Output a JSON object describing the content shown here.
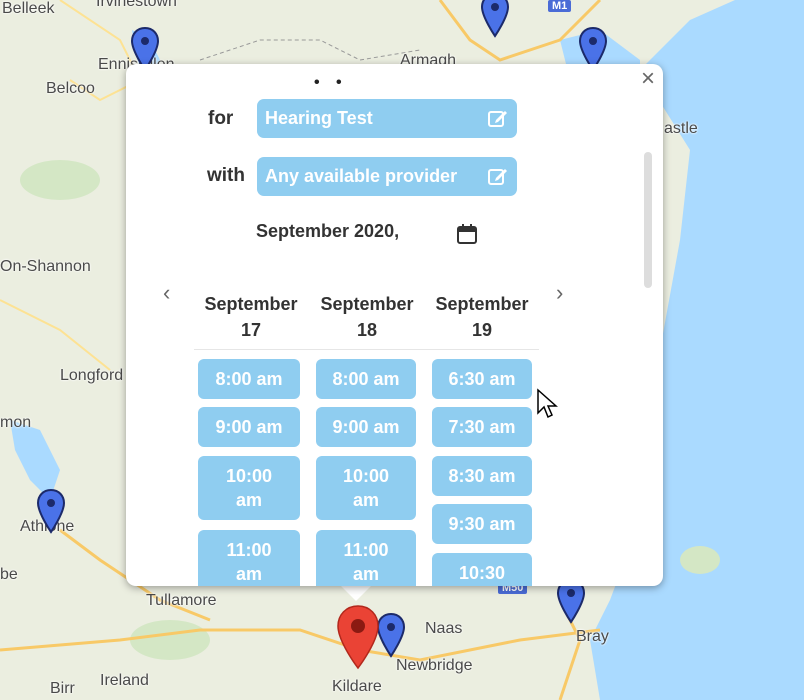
{
  "map": {
    "places": {
      "belleek": "Belleek",
      "irvinestown": "Irvinestown",
      "enniskillen": "Enniskillen",
      "belcoo": "Belcoo",
      "armagh": "Armagh",
      "newcastle": "astle",
      "carrick": "On-Shannon",
      "longford": "Longford",
      "mon": "mon",
      "athlone": "Athlone",
      "be": "be",
      "tullamore": "Tullamore",
      "naas": "Naas",
      "newbridge": "Newbridge",
      "kildare": "Kildare",
      "bray": "Bray",
      "birr": "Birr",
      "ireland": "Ireland",
      "m1": "M1",
      "m50": "M50"
    },
    "colors": {
      "land": "#ebeee0",
      "sea": "#aadaff",
      "pin_blue": "#4a72e8",
      "pin_red": "#ea4335"
    }
  },
  "popup": {
    "close_label": "×",
    "dots": "• •",
    "for_label": "for",
    "service": "Hearing Test",
    "with_label": "with",
    "provider": "Any available provider",
    "month": "September 2020,",
    "prev": "‹",
    "next": "›",
    "days": [
      {
        "title": "September 17",
        "slots": [
          "8:00 am",
          "9:00 am",
          "10:00 am",
          "11:00 am"
        ]
      },
      {
        "title": "September 18",
        "slots": [
          "8:00 am",
          "9:00 am",
          "10:00 am",
          "11:00 am"
        ]
      },
      {
        "title": "September 19",
        "slots": [
          "6:30 am",
          "7:30 am",
          "8:30 am",
          "9:30 am",
          "10:30"
        ]
      }
    ]
  }
}
